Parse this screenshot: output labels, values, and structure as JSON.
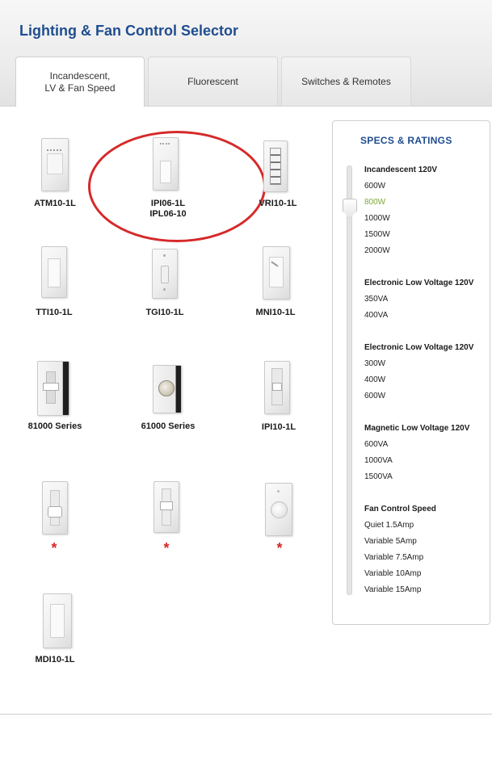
{
  "title": "Lighting & Fan Control Selector",
  "tabs": [
    {
      "label": "Incandescent,\nLV & Fan Speed",
      "active": true
    },
    {
      "label": "Fluorescent",
      "active": false
    },
    {
      "label": "Switches & Remotes",
      "active": false
    }
  ],
  "products": [
    {
      "label": "ATM10-1L"
    },
    {
      "label": "IPI06-1L\nIPL06-10",
      "highlighted": true
    },
    {
      "label": "VRI10-1L"
    },
    {
      "label": "TTI10-1L"
    },
    {
      "label": "TGI10-1L"
    },
    {
      "label": "MNI10-1L"
    },
    {
      "label": "81000 Series"
    },
    {
      "label": "61000 Series"
    },
    {
      "label": "IPI10-1L"
    },
    {
      "label": "*"
    },
    {
      "label": "*"
    },
    {
      "label": "*"
    },
    {
      "label": "MDI10-1L"
    }
  ],
  "specs": {
    "title": "SPECS & RATINGS",
    "groups": [
      {
        "heading": "Incandescent 120V",
        "values": [
          "600W",
          "800W",
          "1000W",
          "1500W",
          "2000W"
        ],
        "selected": "800W"
      },
      {
        "heading": "Electronic Low Voltage 120V",
        "values": [
          "350VA",
          "400VA"
        ]
      },
      {
        "heading": "Electronic Low Voltage 120V",
        "values": [
          "300W",
          "400W",
          "600W"
        ]
      },
      {
        "heading": "Magnetic Low Voltage 120V",
        "values": [
          "600VA",
          "1000VA",
          "1500VA"
        ]
      },
      {
        "heading": "Fan Control Speed",
        "values": [
          "Quiet 1.5Amp",
          "Variable 5Amp",
          "Variable 7.5Amp",
          "Variable 10Amp",
          "Variable 15Amp"
        ]
      }
    ]
  },
  "colors": {
    "title": "#1f4d8f",
    "selected_value": "#7aa83a",
    "highlight": "#d62a2a",
    "asterisk": "#d42a2a"
  }
}
